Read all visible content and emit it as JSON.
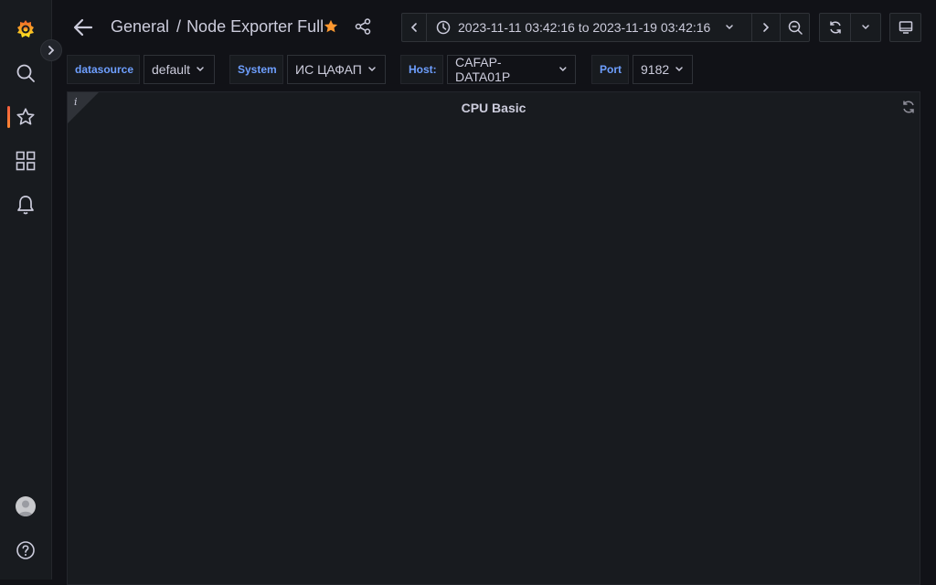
{
  "sidebar": {
    "items": [
      {
        "icon": "grafana-logo-icon"
      },
      {
        "icon": "search-icon"
      },
      {
        "icon": "star-icon",
        "active": true
      },
      {
        "icon": "dashboards-grid-icon"
      },
      {
        "icon": "bell-icon"
      }
    ],
    "bottom": [
      {
        "icon": "avatar"
      },
      {
        "icon": "help-icon"
      }
    ],
    "accent_color": "#f55f3e"
  },
  "header": {
    "folder": "General",
    "separator": "/",
    "dashboard_title": "Node Exporter Full",
    "starred": true,
    "star_color": "#ff9830",
    "time_range": "2023-11-11 03:42:16 to 2023-11-19 03:42:16"
  },
  "variables": [
    {
      "label": "datasource",
      "value": "default"
    },
    {
      "label": "System",
      "value": "ИС ЦАФАП"
    },
    {
      "label": "Host:",
      "value": "CAFAP-DATA01P"
    },
    {
      "label": "Port",
      "value": "9182"
    }
  ],
  "panel": {
    "title": "CPU Basic",
    "info_glyph": "i"
  }
}
